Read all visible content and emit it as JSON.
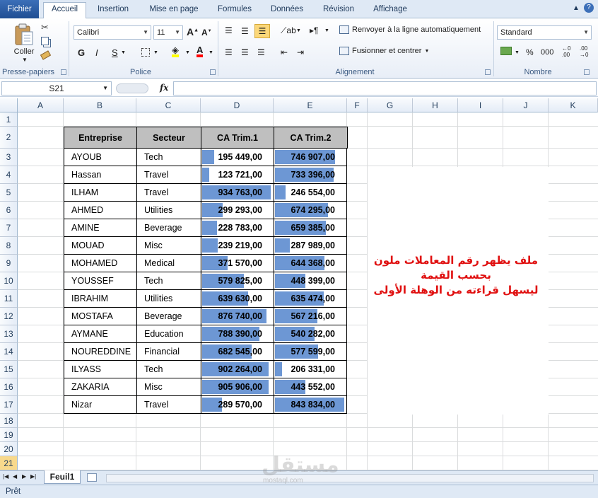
{
  "ribbon": {
    "tabs": [
      "Fichier",
      "Accueil",
      "Insertion",
      "Mise en page",
      "Formules",
      "Données",
      "Révision",
      "Affichage"
    ],
    "clipboard_label": "Presse-papiers",
    "paste_label": "Coller",
    "font_label": "Police",
    "font_name": "Calibri",
    "font_size": "11",
    "bold": "G",
    "italic": "I",
    "underline": "S",
    "alignment_label": "Alignement",
    "wrap_text": "Renvoyer à la ligne automatiquement",
    "merge_center": "Fusionner et centrer",
    "number_label": "Nombre",
    "number_format": "Standard",
    "percent": "%",
    "thousands": "000"
  },
  "formula_bar": {
    "name_box": "S21",
    "fx": "fx",
    "value": ""
  },
  "columns": [
    "A",
    "B",
    "C",
    "D",
    "E",
    "F",
    "G",
    "H",
    "I",
    "J",
    "K"
  ],
  "rows": [
    "1",
    "2",
    "3",
    "4",
    "5",
    "6",
    "7",
    "8",
    "9",
    "10",
    "11",
    "12",
    "13",
    "14",
    "15",
    "16",
    "17",
    "18",
    "19",
    "20",
    "21"
  ],
  "table": {
    "headers": [
      "Entreprise",
      "Secteur",
      "CA Trim.1",
      "CA Trim.2"
    ],
    "rows": [
      {
        "company": "AYOUB",
        "sector": "Tech",
        "t1": "195 449,00",
        "t2": "746 907,00",
        "t1v": 195449,
        "t2v": 746907
      },
      {
        "company": "Hassan",
        "sector": "Travel",
        "t1": "123 721,00",
        "t2": "733 396,00",
        "t1v": 123721,
        "t2v": 733396
      },
      {
        "company": "ILHAM",
        "sector": "Travel",
        "t1": "934 763,00",
        "t2": "246 554,00",
        "t1v": 934763,
        "t2v": 246554
      },
      {
        "company": "AHMED",
        "sector": "Utilities",
        "t1": "299 293,00",
        "t2": "674 295,00",
        "t1v": 299293,
        "t2v": 674295
      },
      {
        "company": "AMINE",
        "sector": "Beverage",
        "t1": "228 783,00",
        "t2": "659 385,00",
        "t1v": 228783,
        "t2v": 659385
      },
      {
        "company": "MOUAD",
        "sector": "Misc",
        "t1": "239 219,00",
        "t2": "287 989,00",
        "t1v": 239219,
        "t2v": 287989
      },
      {
        "company": "MOHAMED",
        "sector": "Medical",
        "t1": "371 570,00",
        "t2": "644 368,00",
        "t1v": 371570,
        "t2v": 644368
      },
      {
        "company": "YOUSSEF",
        "sector": "Tech",
        "t1": "579 825,00",
        "t2": "448 399,00",
        "t1v": 579825,
        "t2v": 448399
      },
      {
        "company": "IBRAHIM",
        "sector": "Utilities",
        "t1": "639 630,00",
        "t2": "635 474,00",
        "t1v": 639630,
        "t2v": 635474
      },
      {
        "company": "MOSTAFA",
        "sector": "Beverage",
        "t1": "876 740,00",
        "t2": "567 216,00",
        "t1v": 876740,
        "t2v": 567216
      },
      {
        "company": "AYMANE",
        "sector": "Education",
        "t1": "788 390,00",
        "t2": "540 282,00",
        "t1v": 788390,
        "t2v": 540282
      },
      {
        "company": "NOUREDDINE",
        "sector": "Financial",
        "t1": "682 545,00",
        "t2": "577 599,00",
        "t1v": 682545,
        "t2v": 577599
      },
      {
        "company": "ILYASS",
        "sector": "Tech",
        "t1": "902 264,00",
        "t2": "206 331,00",
        "t1v": 902264,
        "t2v": 206331
      },
      {
        "company": "ZAKARIA",
        "sector": "Misc",
        "t1": "905 906,00",
        "t2": "443 552,00",
        "t1v": 905906,
        "t2v": 443552
      },
      {
        "company": "Nizar",
        "sector": "Travel",
        "t1": "289 570,00",
        "t2": "843 834,00",
        "t1v": 289570,
        "t2v": 843834
      }
    ]
  },
  "note": {
    "line1": "ملف يظهر رقم المعاملات ملون",
    "line2": "بحسب القيمة",
    "line3": "ليسهل قراءته من الوهلة الأولى",
    "color": "#e01010"
  },
  "bar_color": "#6d97d4",
  "sheet_tab": "Feuil1",
  "status": "Prêt",
  "watermark": "مستقل",
  "watermark_url": "mostaql.com"
}
